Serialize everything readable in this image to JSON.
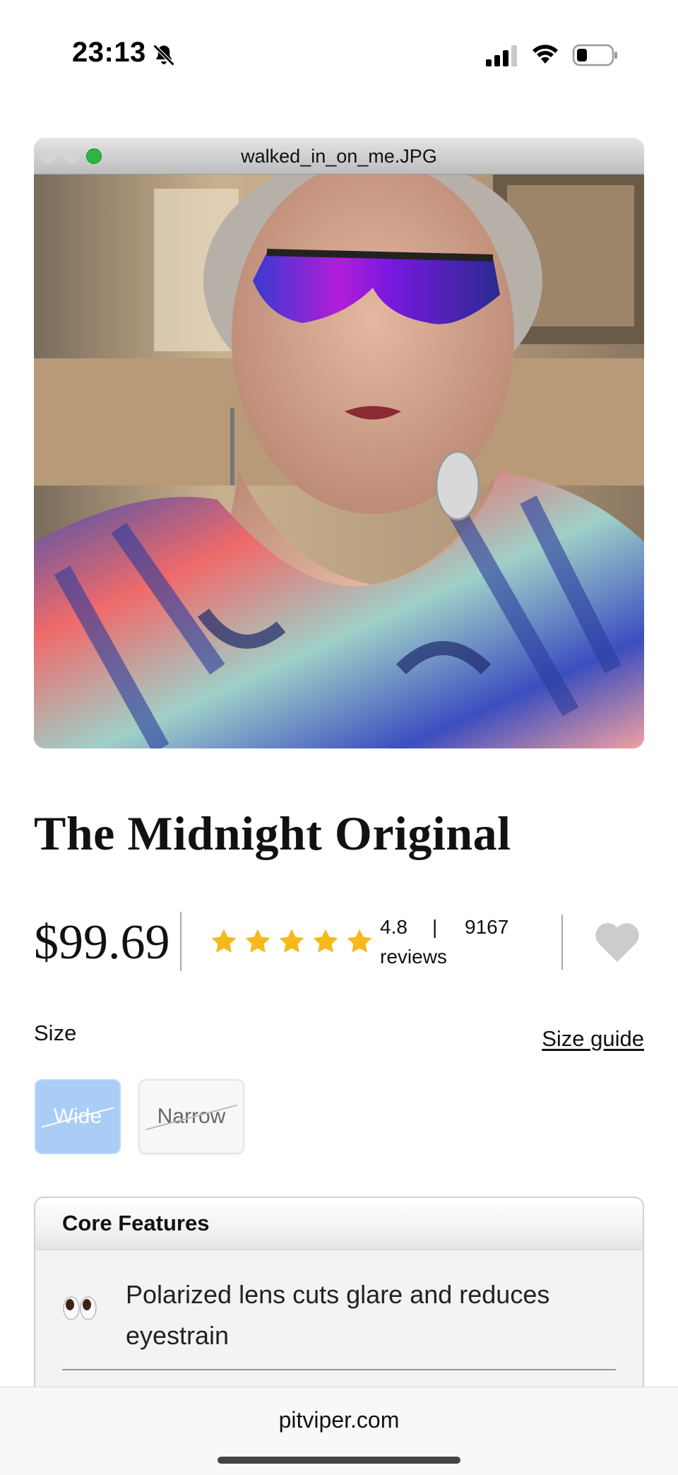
{
  "status_bar": {
    "time": "23:13",
    "icons": [
      "bell-slash-icon",
      "cellular-signal-icon",
      "wifi-icon",
      "battery-icon"
    ]
  },
  "photo_window": {
    "filename": "walked_in_on_me.JPG",
    "image_subject": "photo-of-woman-wearing-sunglasses"
  },
  "product": {
    "title": "The Midnight Original",
    "price": "$99.69",
    "rating": {
      "value": "4.8",
      "separator": "|",
      "count": "9167",
      "label": "reviews",
      "stars": 5
    }
  },
  "size": {
    "label": "Size",
    "guide_link": "Size guide",
    "options": [
      {
        "label": "Wide",
        "selected": true,
        "unavailable": true
      },
      {
        "label": "Narrow",
        "selected": false,
        "unavailable": true
      }
    ]
  },
  "features": {
    "title": "Core Features",
    "items": [
      {
        "icon": "eyes-emoji-icon",
        "text": "Polarized lens cuts glare and reduces eyestrain"
      }
    ]
  },
  "browser": {
    "url": "pitviper.com"
  },
  "colors": {
    "star": "#F6B81A",
    "heart": "#CCCCCC",
    "selected_size": "#A9CDF5"
  }
}
